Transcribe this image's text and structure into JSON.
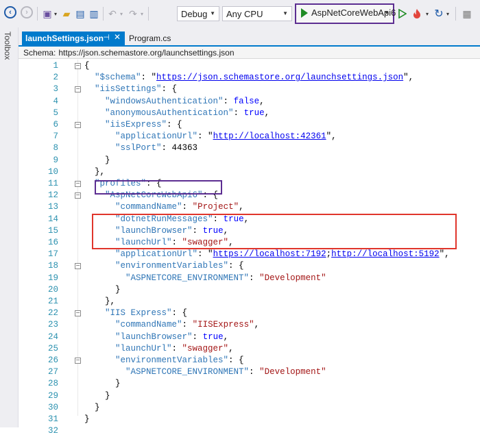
{
  "toolbar": {
    "config_value": "Debug",
    "platform_value": "Any CPU",
    "run_target": "AspNetCoreWebApi6"
  },
  "toolbox": {
    "label": "Toolbox"
  },
  "tabs": [
    {
      "label": "launchSettings.json",
      "active": true
    },
    {
      "label": "Program.cs",
      "active": false
    }
  ],
  "schema": {
    "label": "Schema:",
    "value": "https://json.schemastore.org/launchsettings.json"
  },
  "editor": {
    "lines": [
      {
        "num": "1",
        "segments": [
          {
            "t": "{",
            "c": "n"
          }
        ]
      },
      {
        "num": "2",
        "segments": [
          {
            "t": "  ",
            "c": "n"
          },
          {
            "t": "\"$schema\"",
            "c": "k"
          },
          {
            "t": ": \"",
            "c": "n"
          },
          {
            "t": "https://json.schemastore.org/launchsettings.json",
            "c": "u"
          },
          {
            "t": "\",",
            "c": "n"
          }
        ]
      },
      {
        "num": "3",
        "segments": [
          {
            "t": "  ",
            "c": "n"
          },
          {
            "t": "\"iisSettings\"",
            "c": "k"
          },
          {
            "t": ": {",
            "c": "n"
          }
        ]
      },
      {
        "num": "4",
        "segments": [
          {
            "t": "    ",
            "c": "n"
          },
          {
            "t": "\"windowsAuthentication\"",
            "c": "k"
          },
          {
            "t": ": ",
            "c": "n"
          },
          {
            "t": "false",
            "c": "kw"
          },
          {
            "t": ",",
            "c": "n"
          }
        ]
      },
      {
        "num": "5",
        "segments": [
          {
            "t": "    ",
            "c": "n"
          },
          {
            "t": "\"anonymousAuthentication\"",
            "c": "k"
          },
          {
            "t": ": ",
            "c": "n"
          },
          {
            "t": "true",
            "c": "kw"
          },
          {
            "t": ",",
            "c": "n"
          }
        ]
      },
      {
        "num": "6",
        "segments": [
          {
            "t": "    ",
            "c": "n"
          },
          {
            "t": "\"iisExpress\"",
            "c": "k"
          },
          {
            "t": ": {",
            "c": "n"
          }
        ]
      },
      {
        "num": "7",
        "segments": [
          {
            "t": "      ",
            "c": "n"
          },
          {
            "t": "\"applicationUrl\"",
            "c": "k"
          },
          {
            "t": ": \"",
            "c": "n"
          },
          {
            "t": "http://localhost:42361",
            "c": "u"
          },
          {
            "t": "\",",
            "c": "n"
          }
        ]
      },
      {
        "num": "8",
        "segments": [
          {
            "t": "      ",
            "c": "n"
          },
          {
            "t": "\"sslPort\"",
            "c": "k"
          },
          {
            "t": ": 44363",
            "c": "n"
          }
        ]
      },
      {
        "num": "9",
        "segments": [
          {
            "t": "    }",
            "c": "n"
          }
        ]
      },
      {
        "num": "10",
        "segments": [
          {
            "t": "  },",
            "c": "n"
          }
        ]
      },
      {
        "num": "11",
        "segments": [
          {
            "t": "  ",
            "c": "n"
          },
          {
            "t": "\"profiles\"",
            "c": "k"
          },
          {
            "t": ": {",
            "c": "n"
          }
        ]
      },
      {
        "num": "12",
        "segments": [
          {
            "t": "    ",
            "c": "n"
          },
          {
            "t": "\"AspNetCoreWebApi6\"",
            "c": "k"
          },
          {
            "t": ": {",
            "c": "n"
          }
        ]
      },
      {
        "num": "13",
        "segments": [
          {
            "t": "      ",
            "c": "n"
          },
          {
            "t": "\"commandName\"",
            "c": "k"
          },
          {
            "t": ": ",
            "c": "n"
          },
          {
            "t": "\"Project\"",
            "c": "s"
          },
          {
            "t": ",",
            "c": "n"
          }
        ]
      },
      {
        "num": "14",
        "segments": [
          {
            "t": "      ",
            "c": "n"
          },
          {
            "t": "\"dotnetRunMessages\"",
            "c": "k"
          },
          {
            "t": ": ",
            "c": "n"
          },
          {
            "t": "true",
            "c": "kw"
          },
          {
            "t": ",",
            "c": "n"
          }
        ]
      },
      {
        "num": "15",
        "segments": [
          {
            "t": "      ",
            "c": "n"
          },
          {
            "t": "\"launchBrowser\"",
            "c": "k"
          },
          {
            "t": ": ",
            "c": "n"
          },
          {
            "t": "true",
            "c": "kw"
          },
          {
            "t": ",",
            "c": "n"
          }
        ]
      },
      {
        "num": "16",
        "segments": [
          {
            "t": "      ",
            "c": "n"
          },
          {
            "t": "\"launchUrl\"",
            "c": "k"
          },
          {
            "t": ": ",
            "c": "n"
          },
          {
            "t": "\"swagger\"",
            "c": "s"
          },
          {
            "t": ",",
            "c": "n"
          }
        ]
      },
      {
        "num": "17",
        "segments": [
          {
            "t": "      ",
            "c": "n"
          },
          {
            "t": "\"applicationUrl\"",
            "c": "k"
          },
          {
            "t": ": \"",
            "c": "n"
          },
          {
            "t": "https://localhost:7192",
            "c": "u"
          },
          {
            "t": ";",
            "c": "n"
          },
          {
            "t": "http://localhost:5192",
            "c": "u"
          },
          {
            "t": "\",",
            "c": "n"
          }
        ]
      },
      {
        "num": "18",
        "segments": [
          {
            "t": "      ",
            "c": "n"
          },
          {
            "t": "\"environmentVariables\"",
            "c": "k"
          },
          {
            "t": ": {",
            "c": "n"
          }
        ]
      },
      {
        "num": "19",
        "segments": [
          {
            "t": "        ",
            "c": "n"
          },
          {
            "t": "\"ASPNETCORE_ENVIRONMENT\"",
            "c": "k"
          },
          {
            "t": ": ",
            "c": "n"
          },
          {
            "t": "\"Development\"",
            "c": "s"
          }
        ]
      },
      {
        "num": "20",
        "segments": [
          {
            "t": "      }",
            "c": "n"
          }
        ]
      },
      {
        "num": "21",
        "segments": [
          {
            "t": "    },",
            "c": "n"
          }
        ]
      },
      {
        "num": "22",
        "segments": [
          {
            "t": "    ",
            "c": "n"
          },
          {
            "t": "\"IIS Express\"",
            "c": "k"
          },
          {
            "t": ": {",
            "c": "n"
          }
        ]
      },
      {
        "num": "23",
        "segments": [
          {
            "t": "      ",
            "c": "n"
          },
          {
            "t": "\"commandName\"",
            "c": "k"
          },
          {
            "t": ": ",
            "c": "n"
          },
          {
            "t": "\"IISExpress\"",
            "c": "s"
          },
          {
            "t": ",",
            "c": "n"
          }
        ]
      },
      {
        "num": "24",
        "segments": [
          {
            "t": "      ",
            "c": "n"
          },
          {
            "t": "\"launchBrowser\"",
            "c": "k"
          },
          {
            "t": ": ",
            "c": "n"
          },
          {
            "t": "true",
            "c": "kw"
          },
          {
            "t": ",",
            "c": "n"
          }
        ]
      },
      {
        "num": "25",
        "segments": [
          {
            "t": "      ",
            "c": "n"
          },
          {
            "t": "\"launchUrl\"",
            "c": "k"
          },
          {
            "t": ": ",
            "c": "n"
          },
          {
            "t": "\"swagger\"",
            "c": "s"
          },
          {
            "t": ",",
            "c": "n"
          }
        ]
      },
      {
        "num": "26",
        "segments": [
          {
            "t": "      ",
            "c": "n"
          },
          {
            "t": "\"environmentVariables\"",
            "c": "k"
          },
          {
            "t": ": {",
            "c": "n"
          }
        ]
      },
      {
        "num": "27",
        "segments": [
          {
            "t": "        ",
            "c": "n"
          },
          {
            "t": "\"ASPNETCORE_ENVIRONMENT\"",
            "c": "k"
          },
          {
            "t": ": ",
            "c": "n"
          },
          {
            "t": "\"Development\"",
            "c": "s"
          }
        ]
      },
      {
        "num": "28",
        "segments": [
          {
            "t": "      }",
            "c": "n"
          }
        ]
      },
      {
        "num": "29",
        "segments": [
          {
            "t": "    }",
            "c": "n"
          }
        ]
      },
      {
        "num": "30",
        "segments": [
          {
            "t": "  }",
            "c": "n"
          }
        ]
      },
      {
        "num": "31",
        "segments": [
          {
            "t": "}",
            "c": "n"
          }
        ]
      },
      {
        "num": "32",
        "segments": []
      }
    ],
    "foldable_lines": [
      "1",
      "3",
      "6",
      "11",
      "12",
      "18",
      "22",
      "26"
    ]
  },
  "colors": {
    "accent": "#007acc",
    "highlight_purple": "#5c2d91",
    "highlight_red": "#e0352b",
    "run_green": "#1f8b24"
  }
}
